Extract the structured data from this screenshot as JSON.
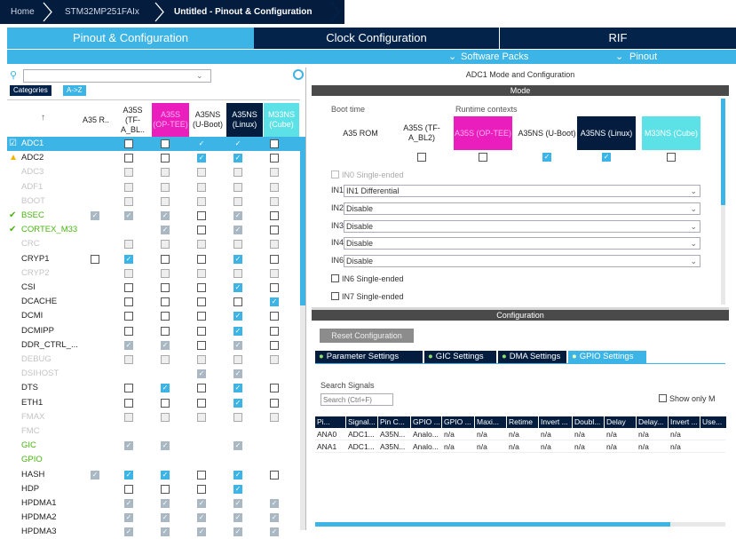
{
  "breadcrumb": {
    "home": "Home",
    "mcu": "STM32MP251FAIx",
    "current": "Untitled - Pinout & Configuration"
  },
  "tabs": [
    "Pinout & Configuration",
    "Clock Configuration",
    "RIF"
  ],
  "subtabs": {
    "software_packs": "Software Packs",
    "pinout": "Pinout"
  },
  "left": {
    "search_value": "",
    "category_tabs": [
      "Categories",
      "A->Z"
    ],
    "sort_icon": "sort-arrow-icon",
    "columns": [
      {
        "label": "A35 R..",
        "bg": "#ffffff",
        "color": "#222222"
      },
      {
        "label": "A35S (TF-A_BL..",
        "bg": "#ffffff",
        "color": "#222222"
      },
      {
        "label": "A35S (OP-TEE)",
        "bg": "#e91ebd",
        "color": "#ffb0ee"
      },
      {
        "label": "A35NS (U-Boot)",
        "bg": "#ffffff",
        "color": "#222222"
      },
      {
        "label": "A35NS (Linux)",
        "bg": "#041d3e",
        "color": "#ffffff"
      },
      {
        "label": "M33NS (Cube)",
        "bg": "#5ce1e6",
        "color": "#ffffff"
      }
    ],
    "rows": [
      {
        "name": "ADC1",
        "status": "ok",
        "selected": true,
        "style": "normal",
        "cells": [
          null,
          "e",
          "e",
          "c",
          "c",
          "e"
        ]
      },
      {
        "name": "ADC2",
        "status": "warn",
        "style": "normal",
        "cells": [
          null,
          "e",
          "e",
          "c",
          "c",
          "e"
        ]
      },
      {
        "name": "ADC3",
        "style": "disabled",
        "cells": [
          null,
          "e",
          "e",
          "e",
          "e",
          "e"
        ]
      },
      {
        "name": "ADF1",
        "style": "disabled",
        "cells": [
          null,
          "e",
          "e",
          "e",
          "e",
          "e"
        ]
      },
      {
        "name": "BOOT",
        "style": "disabled",
        "cells": [
          null,
          "e",
          "e",
          "e",
          "e",
          "e"
        ]
      },
      {
        "name": "BSEC",
        "status": "ok",
        "style": "green",
        "cells": [
          "g",
          "g",
          "g",
          "e",
          "g",
          "e"
        ]
      },
      {
        "name": "CORTEX_M33",
        "status": "ok",
        "style": "green",
        "cells": [
          null,
          null,
          "g",
          "e",
          "g",
          "e"
        ]
      },
      {
        "name": "CRC",
        "style": "disabled",
        "cells": [
          null,
          "e",
          "e",
          "e",
          "e",
          "e"
        ]
      },
      {
        "name": "CRYP1",
        "style": "normal",
        "cells": [
          "e",
          "c",
          "e",
          "e",
          "c",
          "e"
        ]
      },
      {
        "name": "CRYP2",
        "style": "disabled",
        "cells": [
          null,
          "e",
          "e",
          "e",
          "e",
          "e"
        ]
      },
      {
        "name": "CSI",
        "style": "normal",
        "cells": [
          null,
          "e",
          "e",
          "e",
          "c",
          "e"
        ]
      },
      {
        "name": "DCACHE",
        "style": "normal",
        "cells": [
          null,
          "e",
          "e",
          "e",
          "e",
          "c"
        ]
      },
      {
        "name": "DCMI",
        "style": "normal",
        "cells": [
          null,
          "e",
          "e",
          "e",
          "c",
          "e"
        ]
      },
      {
        "name": "DCMIPP",
        "style": "normal",
        "cells": [
          null,
          "e",
          "e",
          "e",
          "c",
          "e"
        ]
      },
      {
        "name": "DDR_CTRL_...",
        "style": "normal",
        "cells": [
          null,
          "g",
          "g",
          "e",
          "g",
          "e"
        ]
      },
      {
        "name": "DEBUG",
        "style": "disabled",
        "cells": [
          null,
          "e",
          "e",
          "e",
          "e",
          "e"
        ]
      },
      {
        "name": "DSIHOST",
        "style": "disabled",
        "cells": [
          null,
          null,
          null,
          "g",
          "g",
          null
        ]
      },
      {
        "name": "DTS",
        "style": "normal",
        "cells": [
          null,
          "e",
          "c",
          "e",
          "c",
          "e"
        ]
      },
      {
        "name": "ETH1",
        "style": "normal",
        "cells": [
          null,
          "e",
          "e",
          "e",
          "c",
          "e"
        ]
      },
      {
        "name": "FMAX",
        "style": "disabled",
        "cells": [
          null,
          "e",
          "e",
          "e",
          "e",
          "e"
        ]
      },
      {
        "name": "FMC",
        "style": "disabled",
        "cells": [
          null,
          null,
          null,
          null,
          null,
          null
        ]
      },
      {
        "name": "GIC",
        "style": "green",
        "cells": [
          null,
          "g",
          "g",
          null,
          "g",
          null
        ]
      },
      {
        "name": "GPIO",
        "style": "green",
        "cells": [
          null,
          null,
          null,
          null,
          null,
          null
        ]
      },
      {
        "name": "HASH",
        "style": "normal",
        "cells": [
          "g",
          "c",
          "c",
          "e",
          "c",
          "e"
        ]
      },
      {
        "name": "HDP",
        "style": "normal",
        "cells": [
          null,
          "e",
          "e",
          "e",
          "c",
          null
        ]
      },
      {
        "name": "HPDMA1",
        "style": "normal",
        "cells": [
          null,
          "g",
          "g",
          "g",
          "g",
          "g"
        ]
      },
      {
        "name": "HPDMA2",
        "style": "normal",
        "cells": [
          null,
          "g",
          "g",
          "g",
          "g",
          "g"
        ]
      },
      {
        "name": "HPDMA3",
        "style": "normal",
        "cells": [
          null,
          "g",
          "g",
          "g",
          "g",
          "g"
        ]
      }
    ]
  },
  "right": {
    "panel_title": "ADC1 Mode and Configuration",
    "mode_title": "Mode",
    "boot_time_label": "Boot time",
    "runtime_label": "Runtime contexts",
    "contexts": [
      {
        "label": "A35 ROM",
        "bg": "#ffffff",
        "color": "#222222",
        "cb": null
      },
      {
        "label": "A35S (TF-A_BL2)",
        "bg": "#ffffff",
        "color": "#222222",
        "cb": "e"
      },
      {
        "label": "A35S (OP-TEE)",
        "bg": "#e91ebd",
        "color": "#ffb0ee",
        "cb": "e"
      },
      {
        "label": "A35NS (U-Boot)",
        "bg": "#ffffff",
        "color": "#222222",
        "cb": "c"
      },
      {
        "label": "A35NS (Linux)",
        "bg": "#041d3e",
        "color": "#ffffff",
        "cb": "c"
      },
      {
        "label": "M33NS (Cube)",
        "bg": "#5ce1e6",
        "color": "#ffffff",
        "cb": "e"
      }
    ],
    "in0_label": "IN0 Single-ended",
    "inputs": [
      {
        "label": "IN1",
        "value": "IN1 Differential"
      },
      {
        "label": "IN2",
        "value": "Disable"
      },
      {
        "label": "IN3",
        "value": "Disable"
      },
      {
        "label": "IN4",
        "value": "Disable"
      },
      {
        "label": "IN6",
        "value": "Disable"
      }
    ],
    "in6_single": "IN6 Single-ended",
    "in7_single": "IN7 Single-ended",
    "config_title": "Configuration",
    "reset_button": "Reset Configuration",
    "config_tabs": [
      "Parameter Settings",
      "GIC Settings",
      "DMA Settings",
      "GPIO Settings"
    ],
    "active_config_tab": 3,
    "search_signals_label": "Search Signals",
    "search_placeholder": "Search (Ctrl+F)",
    "show_only_label": "Show only M",
    "table_headers": [
      "Pi...",
      "Signal...",
      "Pin C...",
      "GPIO ...",
      "GPIO ...",
      "Maxi...",
      "Retime",
      "Invert ...",
      "Doubl...",
      "Delay",
      "Delay...",
      "Invert ...",
      "Use..."
    ],
    "table_rows": [
      [
        "ANA0",
        "ADC1...",
        "A35N...",
        "Analo...",
        "n/a",
        "n/a",
        "n/a",
        "n/a",
        "n/a",
        "n/a",
        "n/a",
        "n/a",
        ""
      ],
      [
        "ANA1",
        "ADC1...",
        "A35N...",
        "Analo...",
        "n/a",
        "n/a",
        "n/a",
        "n/a",
        "n/a",
        "n/a",
        "n/a",
        "n/a",
        ""
      ]
    ]
  },
  "colors": {
    "accent": "#3cb4e6",
    "navy": "#03234b",
    "magenta": "#e91ebd",
    "cyan": "#5ce1e6",
    "green": "#49b50f",
    "warn": "#f0b400"
  }
}
